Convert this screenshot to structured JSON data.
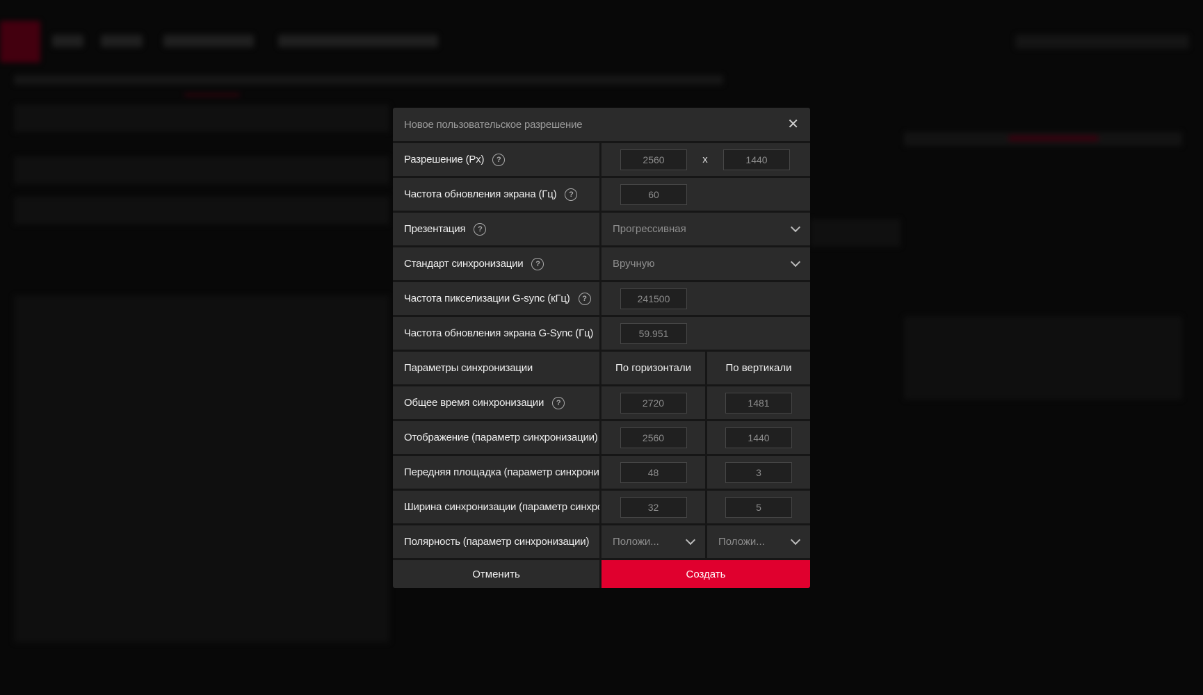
{
  "dialog": {
    "title": "Новое пользовательское разрешение",
    "close_icon": "close-icon",
    "rows": {
      "resolution": {
        "label": "Разрешение (Px)",
        "width": "2560",
        "separator": "x",
        "height": "1440"
      },
      "refresh": {
        "label": "Частота обновления экрана (Гц)",
        "value": "60"
      },
      "presentation": {
        "label": "Презентация",
        "value": "Прогрессивная"
      },
      "timing_standard": {
        "label": "Стандарт синхронизации",
        "value": "Вручную"
      },
      "pixel_clock": {
        "label": "Частота пикселизации G-sync (кГц)",
        "value": "241500"
      },
      "gsync_refresh": {
        "label": "Частота обновления экрана G-Sync (Гц)",
        "value": "59.951"
      },
      "timing_params": {
        "label": "Параметры синхронизации",
        "horizontal": "По горизонтали",
        "vertical": "По вертикали"
      },
      "total": {
        "label": "Общее время синхронизации",
        "h": "2720",
        "v": "1481"
      },
      "display": {
        "label": "Отображение (параметр синхронизации)",
        "h": "2560",
        "v": "1440"
      },
      "front_porch": {
        "label": "Передняя площадка (параметр синхронизации)",
        "h": "48",
        "v": "3"
      },
      "sync_width": {
        "label": "Ширина синхронизации (параметр синхронизации)",
        "h": "32",
        "v": "5"
      },
      "polarity": {
        "label": "Полярность (параметр синхронизации)",
        "h": "Положи...",
        "v": "Положи..."
      }
    },
    "cancel_label": "Отменить",
    "create_label": "Создать"
  },
  "colors": {
    "accent": "#e0002e",
    "panel": "#2b2b2b",
    "background": "#0b0b0b"
  }
}
